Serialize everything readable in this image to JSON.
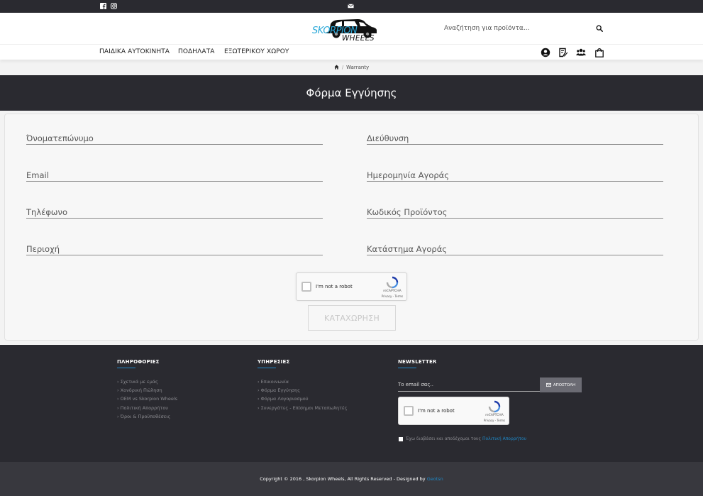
{
  "colors": {
    "dark": "#2a2a30",
    "accent": "#1e88c7",
    "logo_blue": "#2aa8d8"
  },
  "topbar": {
    "icons": [
      "facebook-icon",
      "instagram-icon",
      "mail-icon"
    ]
  },
  "header": {
    "logo_text_1": "SKORPION",
    "logo_text_2": "WHEELS",
    "search": {
      "placeholder": "Αναζήτηση για προϊόντα...",
      "value": ""
    }
  },
  "nav": {
    "items": [
      "ΠΑΙΔΙΚΑ ΑΥΤΟΚΙΝΗΤΑ",
      "ΠΟΔΗΛΑΤΑ",
      "ΕΞΩΤΕΡΙΚΟΥ ΧΩΡΟΥ"
    ],
    "icons": [
      "user-icon",
      "notes-icon",
      "users-group-icon",
      "shopping-bag-icon"
    ]
  },
  "breadcrumb": {
    "current": "Warranty"
  },
  "page": {
    "title": "Φόρμα Εγγύησης"
  },
  "form": {
    "fields": [
      {
        "placeholder": "Όνοματεπώνυμο"
      },
      {
        "placeholder": "Διεύθυνση"
      },
      {
        "placeholder": "Email"
      },
      {
        "placeholder": "Ημερομηνία Αγοράς"
      },
      {
        "placeholder": "Τηλέφωνο"
      },
      {
        "placeholder": "Κωδικός Προϊόντος"
      },
      {
        "placeholder": "Περιοχή"
      },
      {
        "placeholder": "Κατάστημα Αγοράς"
      }
    ],
    "recaptcha": {
      "label": "I'm not a robot",
      "brand": "reCAPTCHA",
      "links": "Privacy - Terms"
    },
    "submit_label": "ΚΑΤΑΧΩΡΗΣΗ"
  },
  "footer": {
    "info": {
      "heading": "ΠΛΗΡΟΦΟΡΙΕΣ",
      "links": [
        "Σχετικά με εμάς",
        "Χονδρική Πώληση",
        "OEM vs Skorpion Wheels",
        "Πολιτική Απορρήτου",
        "Όροι & Προϋποθέσεις"
      ]
    },
    "services": {
      "heading": "ΥΠΗΡΕΣΙΕΣ",
      "links": [
        "Επικοινωνία",
        "Φόρμα Εγγύησης",
        "Φόρμα Λογαριασμού",
        "Συνεργάτες - Επίσημοι Μεταπωλητές"
      ]
    },
    "newsletter": {
      "heading": "NEWSLETTER",
      "email_placeholder": "Το email σας..",
      "send_label": "ΑΠΟΣΤΟΛΗ",
      "recaptcha": {
        "label": "I'm not a robot",
        "brand": "reCAPTCHA",
        "links": "Privacy - Terms"
      },
      "agree_text": "Έχω διαβάσει και αποδέχομαι τους",
      "agree_link": "Πολιτική Απορρήτου"
    }
  },
  "bottom": {
    "copyright": "Copyright © 2016 , Skorpion Wheels, All Rights Reserved - Designed by ",
    "designer": "Geotsn"
  }
}
